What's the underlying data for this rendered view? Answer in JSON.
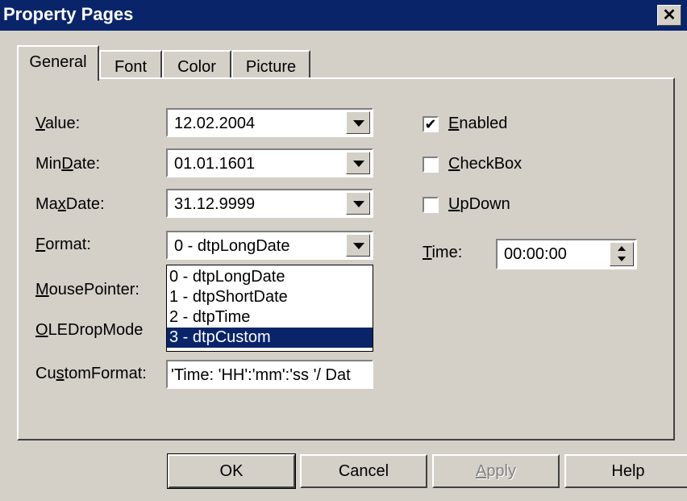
{
  "window": {
    "title": "Property Pages",
    "close_symbol": "✕"
  },
  "tabs": [
    {
      "label": "General"
    },
    {
      "label": "Font"
    },
    {
      "label": "Color"
    },
    {
      "label": "Picture"
    }
  ],
  "labels": {
    "value_u": "V",
    "value_rest": "alue:",
    "mindate_a": "Min",
    "mindate_u": "D",
    "mindate_b": "ate:",
    "maxdate_a": "Ma",
    "maxdate_u": "x",
    "maxdate_b": "Date:",
    "format_u": "F",
    "format_rest": "ormat:",
    "mousepointer_u": "M",
    "mousepointer_rest": "ousePointer:",
    "oledrop_u": "O",
    "oledrop_rest": "LEDropMode",
    "customformat_a": "Cu",
    "customformat_u": "s",
    "customformat_b": "tomFormat:"
  },
  "fields": {
    "value": "12.02.2004",
    "mindate": "01.01.1601",
    "maxdate": "31.12.9999",
    "format": "0 - dtpLongDate",
    "customformat": "'Time: 'HH':'mm':'ss '/ Dat"
  },
  "format_options": [
    "0 - dtpLongDate",
    "1 - dtpShortDate",
    "2 - dtpTime",
    "3 - dtpCustom"
  ],
  "checkboxes": {
    "enabled": {
      "u": "E",
      "rest": "nabled",
      "checked_mark": "✔"
    },
    "checkbox": {
      "u": "C",
      "rest": "heckBox"
    },
    "updown": {
      "u": "U",
      "rest": "pDown"
    }
  },
  "time": {
    "label_u": "T",
    "label_rest": "ime:",
    "value": "00:00:00"
  },
  "buttons": {
    "ok": "OK",
    "cancel": "Cancel",
    "apply_u": "A",
    "apply_rest": "pply",
    "help": "Help"
  }
}
